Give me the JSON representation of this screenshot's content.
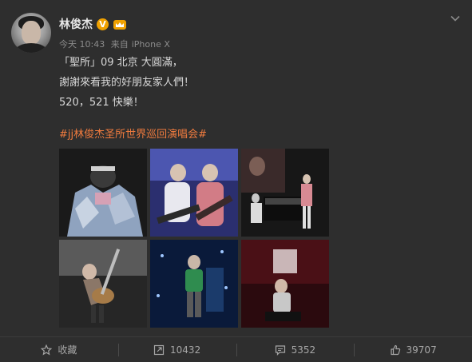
{
  "post": {
    "username": "林俊杰",
    "verified_badge": "V",
    "time": "今天 10:43",
    "source_prefix": "来自",
    "source": "iPhone X",
    "text_lines": [
      "「聖所」09 北京 大圓滿，",
      "謝謝來看我的好朋友家人們！",
      "520，521 快樂！"
    ],
    "hashtag": "#jj林俊杰圣所世界巡回演唱会#",
    "photos": [
      {
        "desc": "performer-in-mask-and-metallic-coat"
      },
      {
        "desc": "performers-with-guitars"
      },
      {
        "desc": "piano-stage"
      },
      {
        "desc": "performer-with-guitar-on-stage"
      },
      {
        "desc": "performer-blue-stage-lights"
      },
      {
        "desc": "performer-seated-red-stage"
      }
    ]
  },
  "actions": {
    "favorite_label": "收藏",
    "repost_count": "10432",
    "comment_count": "5352",
    "like_count": "39707"
  },
  "colors": {
    "background": "#2e2e2e",
    "hashtag": "#f07b3e",
    "badge": "#f0a100"
  }
}
